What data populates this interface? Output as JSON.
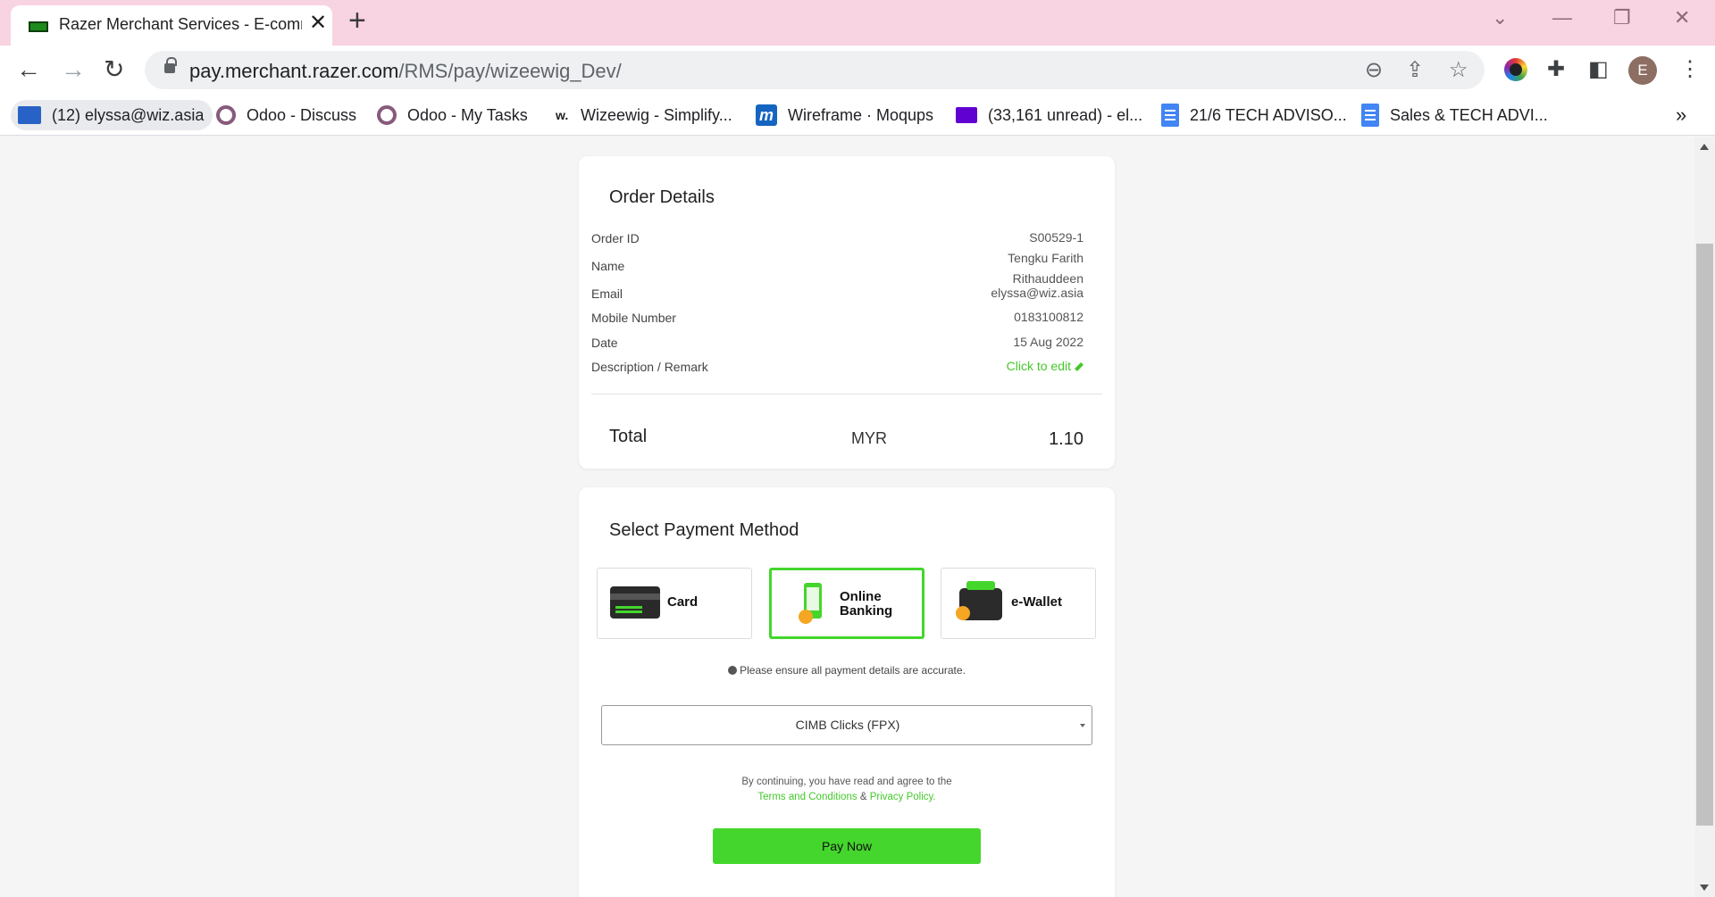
{
  "browser": {
    "tab_title": "Razer Merchant Services - E-commerce",
    "tab_close": "✕",
    "new_tab": "+",
    "url_host": "pay.merchant.razer.com",
    "url_path": "/RMS/pay/wizeewig_Dev/",
    "avatar_letter": "E",
    "bookmarks": [
      {
        "label": "(12) elyssa@wiz.asia",
        "icon": "mail-icon"
      },
      {
        "label": "Odoo - Discuss",
        "icon": "odoo-icon"
      },
      {
        "label": "Odoo - My Tasks",
        "icon": "odoo-icon"
      },
      {
        "label": "Wizeewig - Simplify...",
        "icon": "wizeewig-icon"
      },
      {
        "label": "Wireframe · Moqups",
        "icon": "moqups-icon"
      },
      {
        "label": "(33,161 unread) - el...",
        "icon": "yahoo-mail-icon"
      },
      {
        "label": "21/6 TECH ADVISO...",
        "icon": "google-docs-icon"
      },
      {
        "label": "Sales & TECH ADVI...",
        "icon": "google-docs-icon"
      }
    ],
    "moqups_letter": "m",
    "wizeewig_letter": "w."
  },
  "order": {
    "title": "Order Details",
    "rows": [
      {
        "label": "Order ID",
        "value": "S00529-1"
      },
      {
        "label": "Name",
        "value_line1": "Tengku Farith",
        "value_line2": "Rithauddeen"
      },
      {
        "label": "Email",
        "value": "elyssa@wiz.asia"
      },
      {
        "label": "Mobile Number",
        "value": "0183100812"
      },
      {
        "label": "Date",
        "value": "15 Aug 2022"
      },
      {
        "label": "Description / Remark",
        "value": "Click to edit"
      }
    ],
    "total_label": "Total",
    "currency": "MYR",
    "total_amount": "1.10"
  },
  "payment": {
    "title": "Select Payment Method",
    "methods": [
      {
        "label": "Card",
        "selected": false
      },
      {
        "label_line1": "Online",
        "label_line2": "Banking",
        "selected": true
      },
      {
        "label": "e-Wallet",
        "selected": false
      }
    ],
    "notice": "Please ensure all payment details are accurate.",
    "bank_selected": "CIMB Clicks (FPX)",
    "terms_prefix": "By continuing, you have read and agree to the",
    "terms_link": "Terms and Conditions",
    "terms_amp": "&",
    "privacy_link": "Privacy Policy.",
    "pay_button": "Pay Now"
  },
  "colors": {
    "accent": "#44d62c",
    "link": "#44c82a",
    "titlebar": "#f8d3e1"
  }
}
